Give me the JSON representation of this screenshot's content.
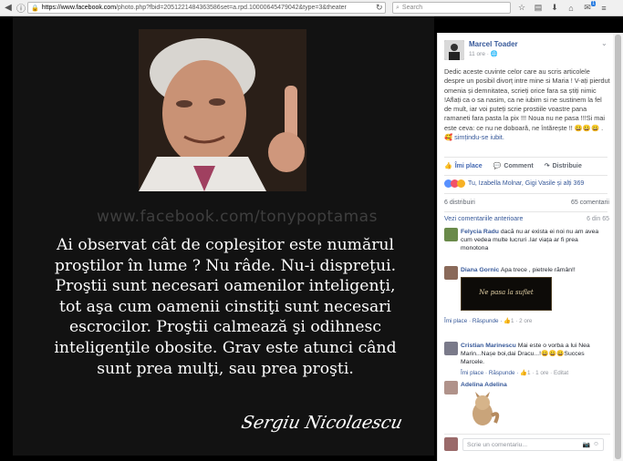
{
  "browser": {
    "url_host": "https://www.facebook.com",
    "url_path": "/photo.php?fbid=2051221484363586set=a.rpd.10000645479042&type=3&theater",
    "search_placeholder": "Search",
    "notification_count": "1"
  },
  "photo": {
    "watermark": "www.facebook.com/tonypoptamas",
    "quote": "Ai observat cât de copleşitor este numărul\nproştilor în lume ? Nu râde. Nu-i dispreţui.\nProştii sunt necesari oamenilor inteligenţi,\ntot aşa cum oamenii cinstiţi sunt necesari\nescrocilor. Proştii calmează şi odihnesc\ninteligenţile obosite. Grav este atunci când\nsunt prea mulţi, sau prea proşti.",
    "signature": "Sergiu Nicolaescu"
  },
  "post": {
    "author": "Marcel Toader",
    "time": "11 ore · 🌐",
    "text": "Dedic aceste cuvinte celor care au scris articolele despre un posibil divorț intre mine si Maria ! V-ați pierdut omenia și demnitatea, scrieți orice fara sa știți nimic !Aflați ca o sa nasim, ca ne iubim si ne sustinem la fel de mult, iar voi puteți scrie prostiile voastre pana ramaneti fara pasta la pix !!! Noua nu ne pasa !!!Si mai este ceva: ce nu ne doboară, ne întărește !! 😀😀😀 .",
    "feeling": "🥰 simțindu-se iubit.",
    "actions": {
      "like": "Îmi place",
      "comment": "Comment",
      "share": "Distribuie"
    },
    "likes_text": "Tu, Izabella Molnar, Gigi Vasile și alți 369",
    "shares": "6 distribuiri",
    "comments_count": "65 comentarii",
    "previous_comments": "Vezi comentariile anterioare",
    "pages": "6 din 65"
  },
  "comments": [
    {
      "name": "Felycia Radu",
      "text": "dacă nu ar exista ei noi nu am avea cum vedea multe lucruri .Iar viața ar fi prea monotona",
      "meta_like": "",
      "meta_reply": "",
      "meta_time": ""
    },
    {
      "name": "Diana Gornic",
      "text": "Apa trece , pietrele rămân!!",
      "image_text": "Ne pasa la suflet",
      "meta_like": "Îmi place",
      "meta_reply": "Răspunde",
      "meta_time": "👍1 · 2 ore"
    },
    {
      "name": "Cristian Marinescu",
      "text": "Mai este o vorba a lui Nea Marin...Nașe boi,dai Dracu...!😀😀😀Succes Marcele.",
      "meta_like": "Îmi place",
      "meta_reply": "Răspunde",
      "meta_time": "👍1 · 1 ore · Editat"
    },
    {
      "name": "Adelina Adelina",
      "text": "",
      "meta_like": "",
      "meta_reply": "",
      "meta_time": ""
    }
  ],
  "write_comment": {
    "placeholder": "Scrie un comentariu..."
  }
}
